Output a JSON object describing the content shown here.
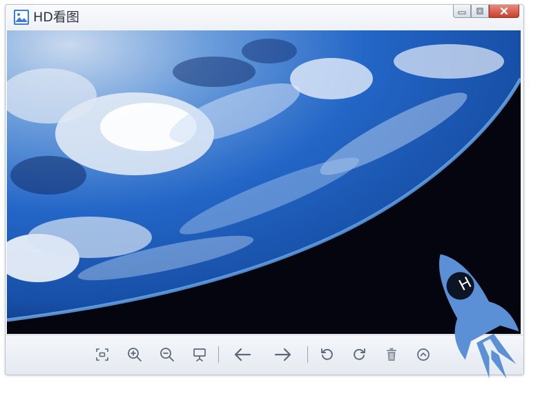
{
  "window": {
    "title": "HD看图"
  },
  "icons": {
    "app": "image-app-icon",
    "minimize": "minimize-icon",
    "restore": "restore-icon",
    "close": "close-icon",
    "rocket": "rocket-logo"
  },
  "toolbar": {
    "buttons": [
      {
        "name": "fit-screen",
        "icon": "fit-screen-icon"
      },
      {
        "name": "zoom-in",
        "icon": "zoom-in-icon"
      },
      {
        "name": "zoom-out",
        "icon": "zoom-out-icon"
      },
      {
        "name": "slideshow",
        "icon": "slideshow-icon"
      },
      {
        "name": "previous",
        "icon": "arrow-left-icon"
      },
      {
        "name": "next",
        "icon": "arrow-right-icon"
      },
      {
        "name": "rotate-left",
        "icon": "rotate-left-icon"
      },
      {
        "name": "rotate-right",
        "icon": "rotate-right-icon"
      },
      {
        "name": "delete",
        "icon": "trash-icon"
      },
      {
        "name": "more",
        "icon": "chevron-up-icon"
      }
    ]
  },
  "colors": {
    "accent": "#4a7fd0",
    "close_button": "#c9402c",
    "space": "#05050f",
    "earth_blue": "#1f63c4",
    "rocket": "#5b8fd6"
  },
  "logo_text": "H"
}
